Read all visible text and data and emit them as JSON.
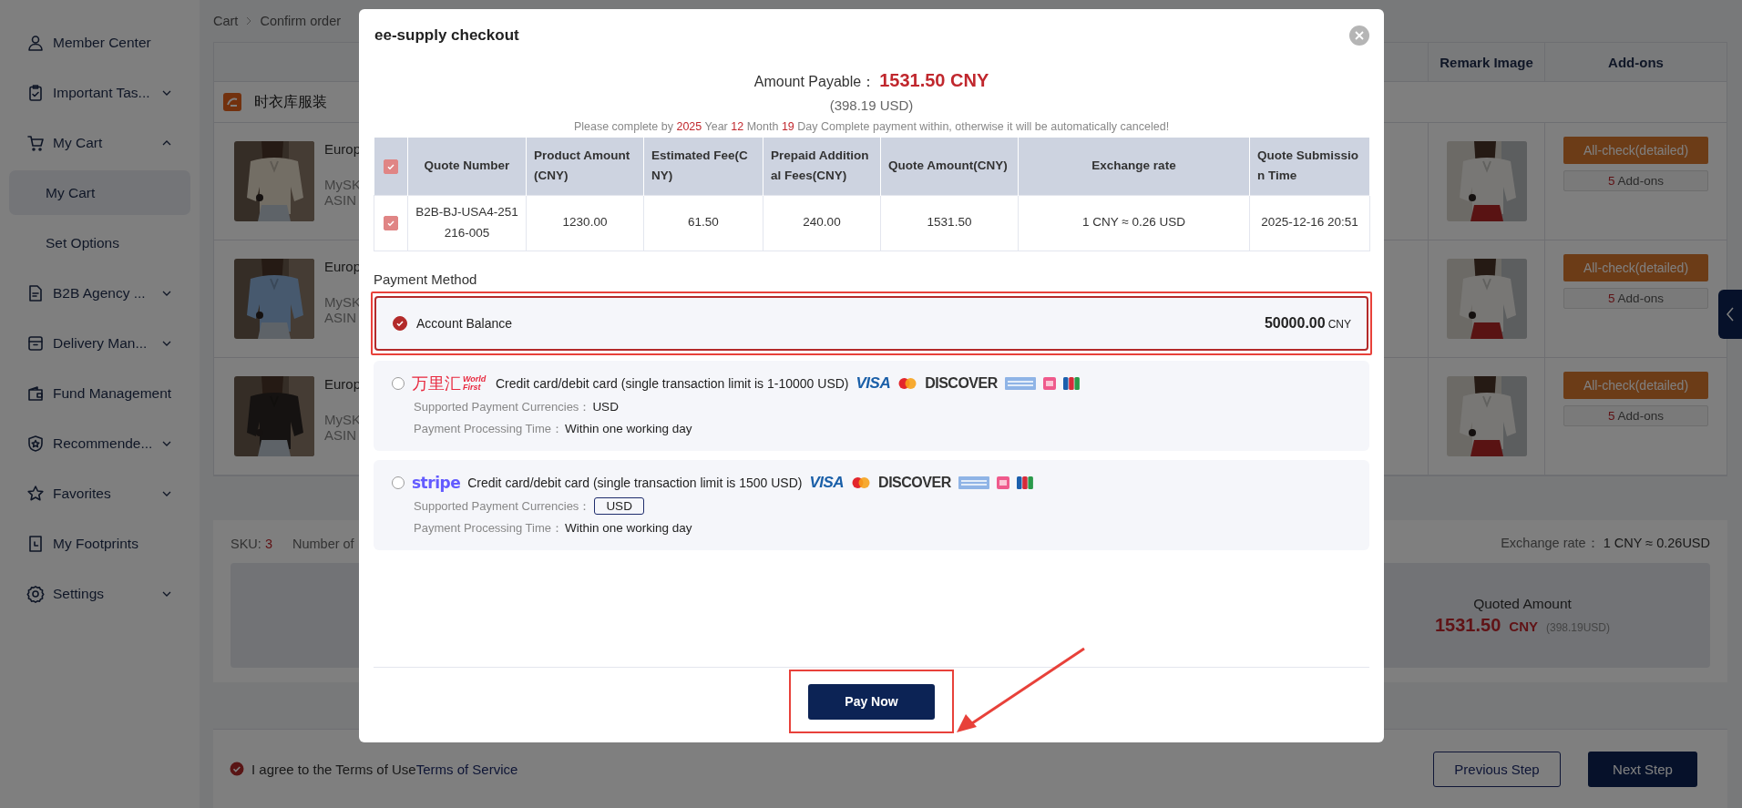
{
  "sidebar": {
    "items": [
      {
        "kind": "link",
        "label": "Member Center"
      },
      {
        "kind": "group",
        "label": "Important Tas...",
        "expanded": false
      },
      {
        "kind": "group",
        "label": "My Cart",
        "expanded": true,
        "children": [
          {
            "label": "My Cart",
            "selected": true
          },
          {
            "label": "Set Options",
            "selected": false
          }
        ]
      },
      {
        "kind": "group",
        "label": "B2B Agency ...",
        "expanded": false
      },
      {
        "kind": "group",
        "label": "Delivery Man...",
        "expanded": false
      },
      {
        "kind": "link",
        "label": "Fund Management"
      },
      {
        "kind": "group",
        "label": "Recommende...",
        "expanded": false
      },
      {
        "kind": "group",
        "label": "Favorites",
        "expanded": false
      },
      {
        "kind": "link",
        "label": "My Footprints"
      },
      {
        "kind": "group",
        "label": "Settings",
        "expanded": false
      }
    ]
  },
  "breadcrumb": [
    "Cart",
    "Confirm order"
  ],
  "cart_table": {
    "columns": [
      "Remark Image",
      "Add-ons"
    ],
    "shop": "时衣库服装",
    "rows": [
      {
        "title": "Europ",
        "line_2": "MySK",
        "line_3": "ASIN",
        "action": "All-check(detailed)",
        "addons_count": "5",
        "addons_label": "Add-ons"
      },
      {
        "title": "Europ",
        "line_2": "MySK",
        "line_3": "ASIN",
        "action": "All-check(detailed)",
        "addons_count": "5",
        "addons_label": "Add-ons"
      },
      {
        "title": "Europ",
        "line_2": "MySK",
        "line_3": "ASIN",
        "action": "All-check(detailed)",
        "addons_count": "5",
        "addons_label": "Add-ons"
      }
    ]
  },
  "summary": {
    "sku_label": "SKU:",
    "sku_value": "3",
    "number_label": "Number of",
    "exchange_label": "Exchange rate：",
    "exchange_value": "1 CNY ≈ 0.26USD",
    "quoted_label": "Quoted Amount",
    "quoted_value": "1531.50",
    "quoted_currency": "CNY",
    "quoted_usd": "(398.19USD)"
  },
  "footer": {
    "agree_checked": true,
    "agree_text": "I agree to the Terms of Use",
    "terms_link": "Terms of Service",
    "previous": "Previous Step",
    "next": "Next Step"
  },
  "modal": {
    "title": "ee-supply checkout",
    "amount_label": "Amount Payable：",
    "amount": "1531.50 CNY",
    "amount_usd": "(398.19 USD)",
    "deadline": [
      {
        "text": "Please complete by",
        "highlight": false
      },
      {
        "text": "2025",
        "highlight": true
      },
      {
        "text": "Year",
        "highlight": false
      },
      {
        "text": "12",
        "highlight": true
      },
      {
        "text": "Month",
        "highlight": false
      },
      {
        "text": "19",
        "highlight": true
      },
      {
        "text": "Day Complete payment within, otherwise it will be automatically canceled!",
        "highlight": false
      }
    ],
    "quote_table": {
      "columns": [
        {
          "kind": "checkbox",
          "checked": true
        },
        {
          "kind": "text",
          "label": "Quote Number"
        },
        {
          "kind": "text",
          "label": "Product Amount (CNY)"
        },
        {
          "kind": "text",
          "label": "Estimated Fee(CNY)"
        },
        {
          "kind": "text",
          "label": "Prepaid Additional Fees(CNY)"
        },
        {
          "kind": "text",
          "label": "Quote Amount(CNY)"
        },
        {
          "kind": "text",
          "label": "Exchange rate"
        },
        {
          "kind": "text",
          "label": "Quote Submission Time"
        }
      ],
      "rows": [
        {
          "cells": [
            {
              "kind": "checkbox",
              "checked": true
            },
            {
              "kind": "text",
              "text": "B2B-BJ-USA4-251216-005"
            },
            {
              "kind": "text",
              "text": "1230.00"
            },
            {
              "kind": "text",
              "text": "61.50"
            },
            {
              "kind": "text",
              "text": "240.00"
            },
            {
              "kind": "text",
              "text": "1531.50"
            },
            {
              "kind": "text",
              "text": "1 CNY ≈ 0.26 USD"
            },
            {
              "kind": "text",
              "text": "2025-12-16 20:51"
            }
          ]
        }
      ]
    },
    "payment_title": "Payment Method",
    "methods": [
      {
        "kind": "balance",
        "selected": true,
        "label": "Account Balance",
        "amount": "50000.00",
        "currency": "CNY"
      },
      {
        "kind": "card",
        "selected": false,
        "color": "#e8283e",
        "logo": "万里汇",
        "logo_sub": "World First",
        "description": "Credit card/debit card (single transaction limit is 1-10000 USD)",
        "brands": [
          {
            "kind": "visa",
            "label": "VISA"
          },
          {
            "kind": "mastercard"
          },
          {
            "kind": "discover",
            "label": "DISCOVER"
          },
          {
            "kind": "amex"
          },
          {
            "kind": "pink"
          },
          {
            "kind": "jcb"
          }
        ],
        "currencies_label": "Supported Payment Currencies：",
        "currencies": "USD",
        "currency_boxed": false,
        "time_label": "Payment Processing Time：",
        "time": "Within one working day"
      },
      {
        "kind": "card",
        "selected": false,
        "color": "#635bff",
        "logo": "stripe",
        "description": "Credit card/debit card (single transaction limit is 1500 USD)",
        "brands": [
          {
            "kind": "visa",
            "label": "VISA"
          },
          {
            "kind": "mastercard"
          },
          {
            "kind": "discover",
            "label": "DISCOVER"
          },
          {
            "kind": "amex"
          },
          {
            "kind": "pink"
          },
          {
            "kind": "jcb"
          }
        ],
        "currencies_label": "Supported Payment Currencies：",
        "currencies": "USD",
        "currency_boxed": true,
        "time_label": "Payment Processing Time：",
        "time": "Within one working day"
      }
    ],
    "pay_button": "Pay Now"
  }
}
